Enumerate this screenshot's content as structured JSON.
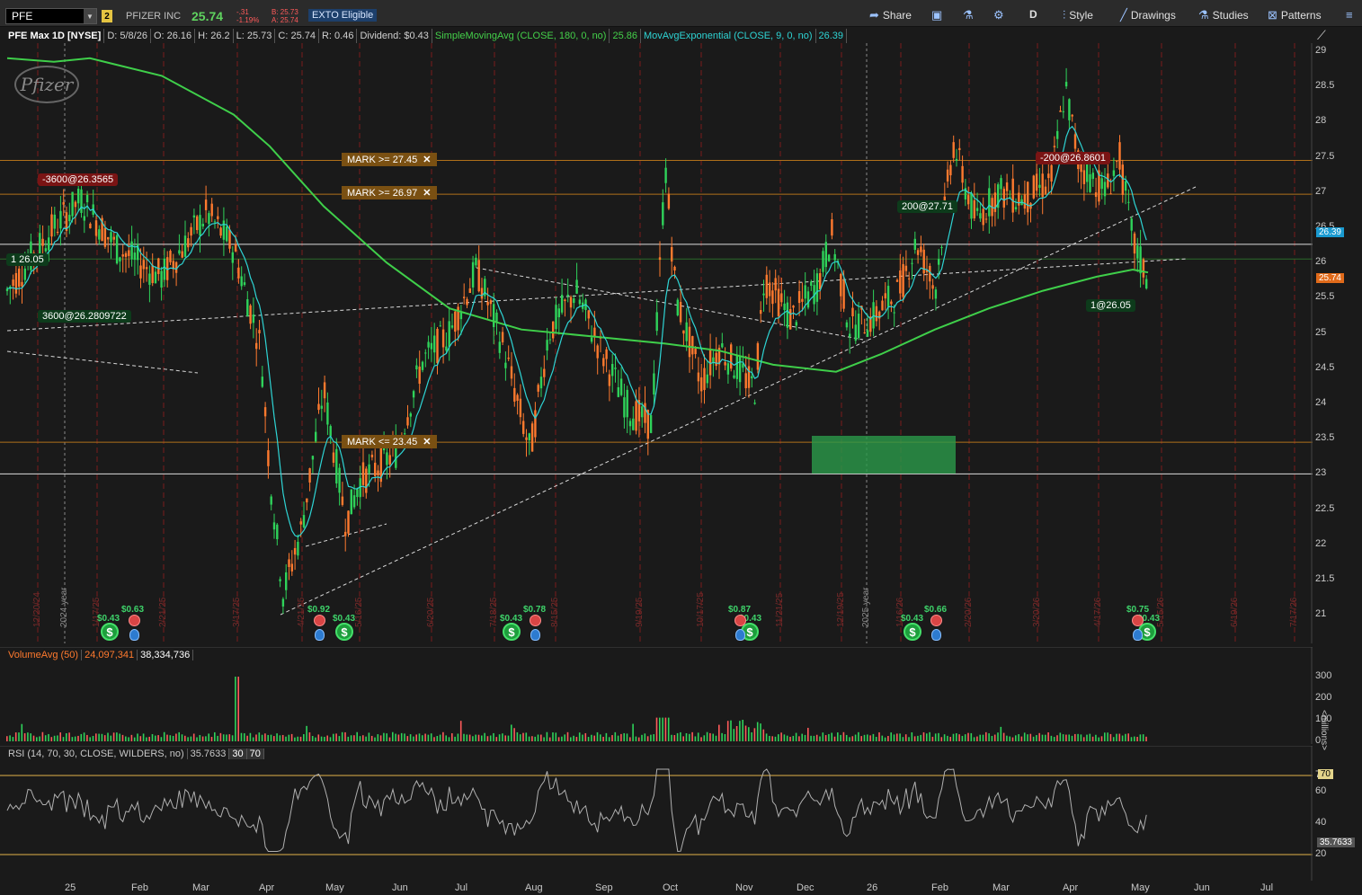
{
  "toolbar": {
    "symbol": "PFE",
    "link_group": "2",
    "company": "PFIZER INC",
    "last_price": "25.74",
    "change": "-.31",
    "change_pct": "-1.19%",
    "bid": "B: 25.73",
    "ask": "A: 25.74",
    "exto": "EXTO Eligible",
    "share_label": "Share",
    "period_label": "D",
    "style_label": "Style",
    "drawings_label": "Drawings",
    "studies_label": "Studies",
    "patterns_label": "Patterns"
  },
  "header": {
    "title": "PFE Max 1D [NYSE]",
    "date": "D: 5/8/26",
    "open": "O: 26.16",
    "high": "H: 26.2",
    "low": "L: 25.73",
    "close": "C: 25.74",
    "range": "R: 0.46",
    "dividend": "Dividend: $0.43",
    "sma_label": "SimpleMovingAvg (CLOSE, 180, 0, no)",
    "sma_value": "25.86",
    "ema_label": "MovAvgExponential (CLOSE, 9, 0, no)",
    "ema_value": "26.39"
  },
  "price_axis": [
    "29",
    "28.5",
    "28",
    "27.5",
    "27",
    "26.5",
    "26",
    "25.5",
    "25",
    "24.5",
    "24",
    "23.5",
    "23",
    "22.5",
    "22",
    "21.5",
    "21"
  ],
  "price_flags": {
    "ema": "26.39",
    "last": "25.74"
  },
  "orders": [
    {
      "text": "-3600@26.3565",
      "kind": "sell"
    },
    {
      "text": "3600@26.2809722",
      "kind": "buy"
    },
    {
      "text": "1 26.05",
      "kind": "buy"
    },
    {
      "text": "200@27.71",
      "kind": "buy"
    },
    {
      "text": "-200@26.8601",
      "kind": "sell"
    },
    {
      "text": "1@26.05",
      "kind": "buy"
    }
  ],
  "marks": [
    {
      "text": "MARK >= 27.45"
    },
    {
      "text": "MARK >= 26.97"
    },
    {
      "text": "MARK <= 23.45"
    }
  ],
  "dividends": [
    "$0.43",
    "$0.63",
    "$0.92",
    "$0.43",
    "$0.43",
    "$0.78",
    "$0.87",
    "$0.43",
    "$0.43",
    "$0.66",
    "$0.75",
    "$0.43"
  ],
  "vertical_dates": [
    "12/20/24",
    "1/17/25",
    "2/21/25",
    "3/17/25",
    "4/21/25",
    "5/16/25",
    "6/20/25",
    "7/18/25",
    "8/15/25",
    "9/19/25",
    "10/17/25",
    "11/21/25",
    "12/19/25",
    "1/16/26",
    "2/20/26",
    "3/20/26",
    "4/17/26",
    "5/15/26",
    "6/19/26",
    "7/17/26"
  ],
  "year_labels": [
    "2024 year",
    "2025 year"
  ],
  "volume": {
    "study": "VolumeAvg (50)",
    "avg": "24,097,341",
    "vol": "38,334,736",
    "axis": [
      "300",
      "200",
      "100",
      "0"
    ],
    "unit": "<millions>"
  },
  "rsi": {
    "study": "RSI (14, 70, 30, CLOSE, WILDERS, no)",
    "value": "35.7633",
    "ob_label": "30",
    "os_label": "70",
    "axis": [
      "70",
      "60",
      "40",
      "20"
    ],
    "flag_70": "70",
    "flag_val": "35.7633"
  },
  "time_axis": [
    "25",
    "Feb",
    "Mar",
    "Apr",
    "May",
    "Jun",
    "Jul",
    "Aug",
    "Sep",
    "Oct",
    "Nov",
    "Dec",
    "26",
    "Feb",
    "Mar",
    "Apr",
    "May",
    "Jun",
    "Jul"
  ],
  "logo_text": "Pfizer",
  "colors": {
    "up": "#2fd35a",
    "down": "#ff7a2e",
    "sma": "#3fcf4a",
    "ema": "#2ed4d4",
    "mark": "#7a5012",
    "buy": "#0d3b1b",
    "sell": "#7a1414"
  }
}
